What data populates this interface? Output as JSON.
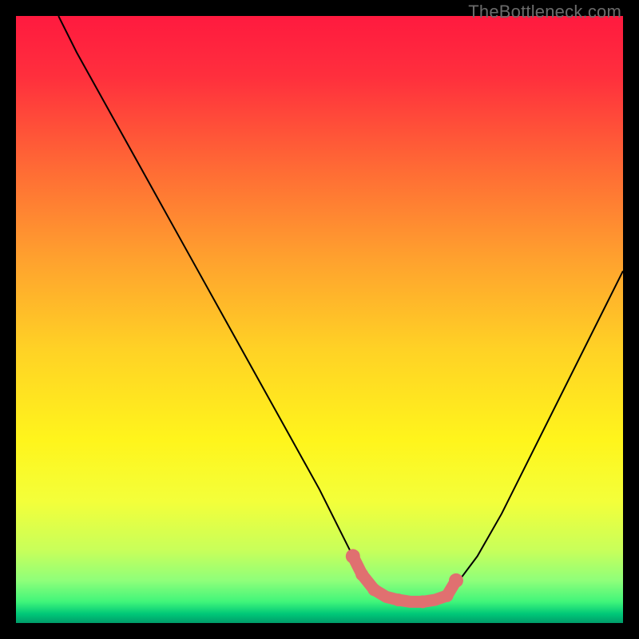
{
  "watermark": "TheBottleneck.com",
  "chart_data": {
    "type": "line",
    "title": "",
    "xlabel": "",
    "ylabel": "",
    "xlim": [
      0,
      100
    ],
    "ylim": [
      0,
      100
    ],
    "series": [
      {
        "name": "bottleneck-curve",
        "x": [
          7,
          10,
          15,
          20,
          25,
          30,
          35,
          40,
          45,
          50,
          53,
          55,
          57,
          59,
          61,
          63,
          65,
          67,
          69,
          71,
          73,
          76,
          80,
          85,
          90,
          95,
          100
        ],
        "y": [
          100,
          94,
          85,
          76,
          67,
          58,
          49,
          40,
          31,
          22,
          16,
          12,
          9,
          6.5,
          5,
          4,
          3.5,
          3.5,
          4,
          5,
          7,
          11,
          18,
          28,
          38,
          48,
          58
        ]
      }
    ],
    "flat_marker": {
      "color": "#e07070",
      "points_x": [
        55.5,
        57,
        59,
        61,
        63,
        65,
        67,
        69,
        71,
        72.5
      ],
      "points_y": [
        11,
        8,
        5.5,
        4.3,
        3.8,
        3.5,
        3.5,
        3.8,
        4.5,
        7
      ]
    },
    "gradient_stops": [
      {
        "offset": 0.0,
        "color": "#ff1a3f"
      },
      {
        "offset": 0.1,
        "color": "#ff2f3d"
      },
      {
        "offset": 0.25,
        "color": "#ff6a35"
      },
      {
        "offset": 0.4,
        "color": "#ffa12e"
      },
      {
        "offset": 0.55,
        "color": "#ffd225"
      },
      {
        "offset": 0.7,
        "color": "#fff51c"
      },
      {
        "offset": 0.8,
        "color": "#f3ff3a"
      },
      {
        "offset": 0.88,
        "color": "#c8ff5a"
      },
      {
        "offset": 0.93,
        "color": "#8fff7a"
      },
      {
        "offset": 0.965,
        "color": "#40f57a"
      },
      {
        "offset": 0.985,
        "color": "#00c878"
      },
      {
        "offset": 1.0,
        "color": "#009c6a"
      }
    ]
  }
}
